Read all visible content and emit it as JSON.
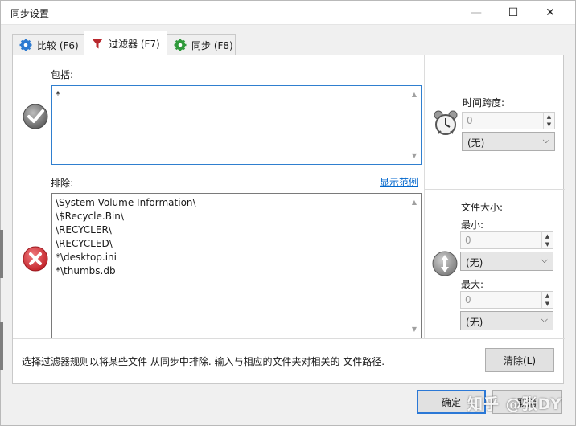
{
  "window": {
    "title": "同步设置",
    "min_label": "—",
    "max_label": "☐",
    "close_label": "✕"
  },
  "tabs": [
    {
      "label": "比较 (F6)",
      "icon": "gear-blue-icon"
    },
    {
      "label": "过滤器 (F7)",
      "icon": "funnel-red-icon",
      "active": true
    },
    {
      "label": "同步 (F8)",
      "icon": "gear-green-icon"
    }
  ],
  "include": {
    "label": "包括:",
    "value": "*"
  },
  "exclude": {
    "label": "排除:",
    "show_examples": "显示范例",
    "lines": [
      "\\System Volume Information\\",
      "\\$Recycle.Bin\\",
      "\\RECYCLER\\",
      "\\RECYCLED\\",
      "*\\desktop.ini",
      "*\\thumbs.db"
    ]
  },
  "time_span": {
    "label": "时间跨度:",
    "value": "0",
    "unit": "(无)"
  },
  "file_size": {
    "label": "文件大小:",
    "min_label": "最小:",
    "min_value": "0",
    "min_unit": "(无)",
    "max_label": "最大:",
    "max_value": "0",
    "max_unit": "(无)"
  },
  "hint": "选择过滤器规则以将某些文件 从同步中排除. 输入与相应的文件夹对相关的 文件路径.",
  "clear_button": "清除(L)",
  "ok_button": "确定",
  "cancel_button": "取消",
  "watermark": "知乎 @张DY",
  "colors": {
    "accent": "#2b78d6",
    "link": "#0066cc",
    "exclude_red": "#d9343a",
    "include_gray": "#6d6d6d"
  }
}
